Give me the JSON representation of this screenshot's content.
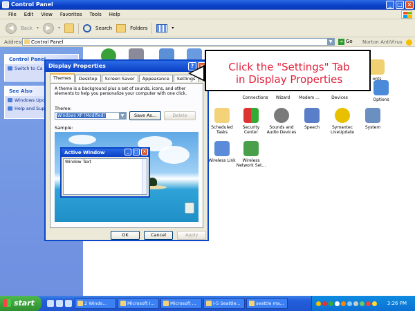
{
  "window": {
    "title": "Control Panel"
  },
  "menu": [
    "File",
    "Edit",
    "View",
    "Favorites",
    "Tools",
    "Help"
  ],
  "toolbar": {
    "back": "Back",
    "search": "Search",
    "folders": "Folders"
  },
  "address": {
    "label": "Address",
    "value": "Control Panel",
    "go": "Go",
    "norton": "Norton AntiVirus"
  },
  "taskpane": {
    "control_panel_title": "Control Panel",
    "switch_item": "Switch to Ca",
    "see_also_title": "See Also",
    "see_also_items": [
      "Windows Upd",
      "Help and Sup"
    ]
  },
  "icons": {
    "fonts": "onts",
    "options": "Options",
    "connections": "Connections",
    "wizard": "Wizard",
    "modem": "Modem ...",
    "devices": "Devices",
    "scheduled": "Scheduled\nTasks",
    "security": "Security\nCenter",
    "sounds": "Sounds and\nAudio Devices",
    "speech": "Speech",
    "symantec": "Symantec\nLiveUpdate",
    "system": "System",
    "wireless_link": "Wireless Link",
    "wireless_net": "Wireless\nNetwork Set..."
  },
  "dialog": {
    "title": "Display Properties",
    "tabs": [
      "Themes",
      "Desktop",
      "Screen Saver",
      "Appearance",
      "Settings"
    ],
    "description": "A theme is a background plus a set of sounds, icons, and other elements to help you personalize your computer with one click.",
    "theme_label": "Theme:",
    "theme_value": "Windows XP (Modified)",
    "save_as": "Save As...",
    "delete": "Delete",
    "sample_label": "Sample:",
    "active_window_title": "Active Window",
    "window_text": "Window Text",
    "ok": "OK",
    "cancel": "Cancel",
    "apply": "Apply"
  },
  "callout": {
    "line1": "Click the \"Settings\" Tab",
    "line2": "in Display Properties"
  },
  "taskbar": {
    "start": "start",
    "tasks": [
      "2 Windo...",
      "Microsoft I...",
      "Microsoft ...",
      "I-5 Seattle...",
      "seattle ma..."
    ],
    "clock": "3:26 PM"
  },
  "colors": {
    "callout_text": "#e0203a",
    "xp_blue": "#0a3fc4",
    "start_green": "#2e8f2e"
  }
}
